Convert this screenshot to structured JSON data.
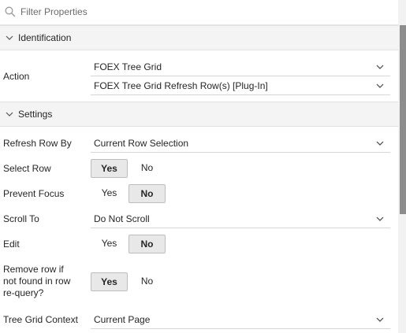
{
  "filter": {
    "placeholder": "Filter Properties",
    "icon": "search-icon"
  },
  "sections": {
    "identification": {
      "title": "Identification"
    },
    "settings": {
      "title": "Settings"
    }
  },
  "identification": {
    "action_label": "Action",
    "action_value": "FOEX Tree Grid",
    "action_plugin_value": "FOEX Tree Grid Refresh Row(s) [Plug-In]"
  },
  "settings": {
    "refresh_row_by": {
      "label": "Refresh Row By",
      "value": "Current Row Selection"
    },
    "select_row": {
      "label": "Select Row",
      "yes": "Yes",
      "no": "No",
      "selected": "Yes"
    },
    "prevent_focus": {
      "label": "Prevent Focus",
      "yes": "Yes",
      "no": "No",
      "selected": "No"
    },
    "scroll_to": {
      "label": "Scroll To",
      "value": "Do Not Scroll"
    },
    "edit": {
      "label": "Edit",
      "yes": "Yes",
      "no": "No",
      "selected": "No"
    },
    "remove_row": {
      "label_line1": "Remove row if",
      "label_line2": "not found in row",
      "label_line3": "re-query?",
      "yes": "Yes",
      "no": "No",
      "selected": "Yes"
    },
    "tree_grid_context": {
      "label": "Tree Grid Context",
      "value": "Current Page"
    }
  }
}
